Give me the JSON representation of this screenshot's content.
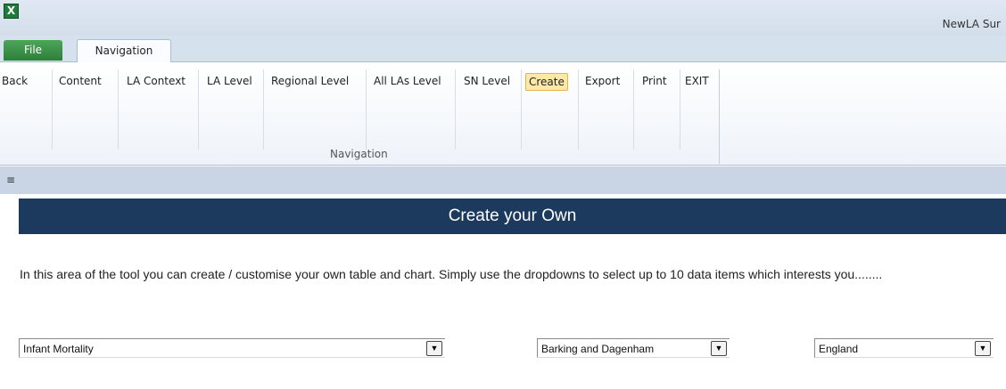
{
  "window": {
    "title": "NewLA Sur"
  },
  "tabs": {
    "file": "File",
    "navigation": "Navigation"
  },
  "ribbon": {
    "buttons": [
      "Back",
      "Content",
      "LA Context",
      "LA Level",
      "Regional Level",
      "All LAs Level",
      "SN Level",
      "Create",
      "Export",
      "Print",
      "EXIT"
    ],
    "active": "Create",
    "group_label": "Navigation"
  },
  "qat": {
    "arrow": "≡"
  },
  "sheet": {
    "banner": "Create your Own",
    "intro": "In this area of the tool you can create / customise your own table and chart.  Simply use the dropdowns to select up to 10 data items which interests you........",
    "dropdowns": [
      {
        "value": "Infant Mortality"
      },
      {
        "value": "Barking and Dagenham"
      },
      {
        "value": "England"
      }
    ]
  },
  "icons": {
    "dropdown": "chevron-down-icon",
    "app": "excel-icon"
  }
}
